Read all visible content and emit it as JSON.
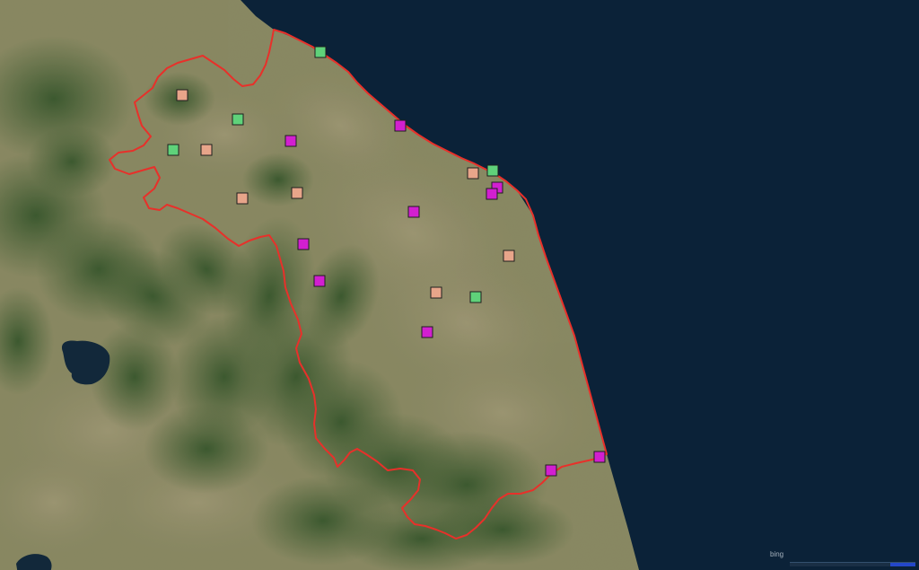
{
  "map": {
    "basemap": "satellite-imagery",
    "attribution": "bing",
    "colors": {
      "sea": "#0b2238",
      "land": "#8a8a63",
      "forest": "#3b5a2e",
      "boundary": "#e8302a"
    },
    "marker_categories": {
      "salmon": "#e8a58a",
      "green": "#5fd27a",
      "magenta": "#d21fd0"
    }
  }
}
